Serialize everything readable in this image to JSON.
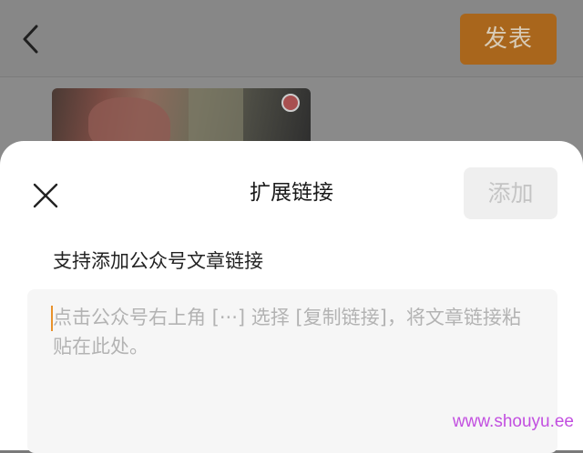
{
  "header": {
    "publish_label": "发表"
  },
  "sheet": {
    "title": "扩展链接",
    "add_label": "添加",
    "support_text": "支持添加公众号文章链接",
    "input_placeholder": "点击公众号右上角 [···] 选择 [复制链接]，将文章链接粘贴在此处。"
  },
  "icons": {
    "back": "back-chevron-icon",
    "close": "close-icon"
  },
  "colors": {
    "accent": "#e8922b",
    "publish_dimmed": "#a9661c",
    "watermark": "#c24fe0"
  },
  "watermark": "www.shouyu.ee"
}
